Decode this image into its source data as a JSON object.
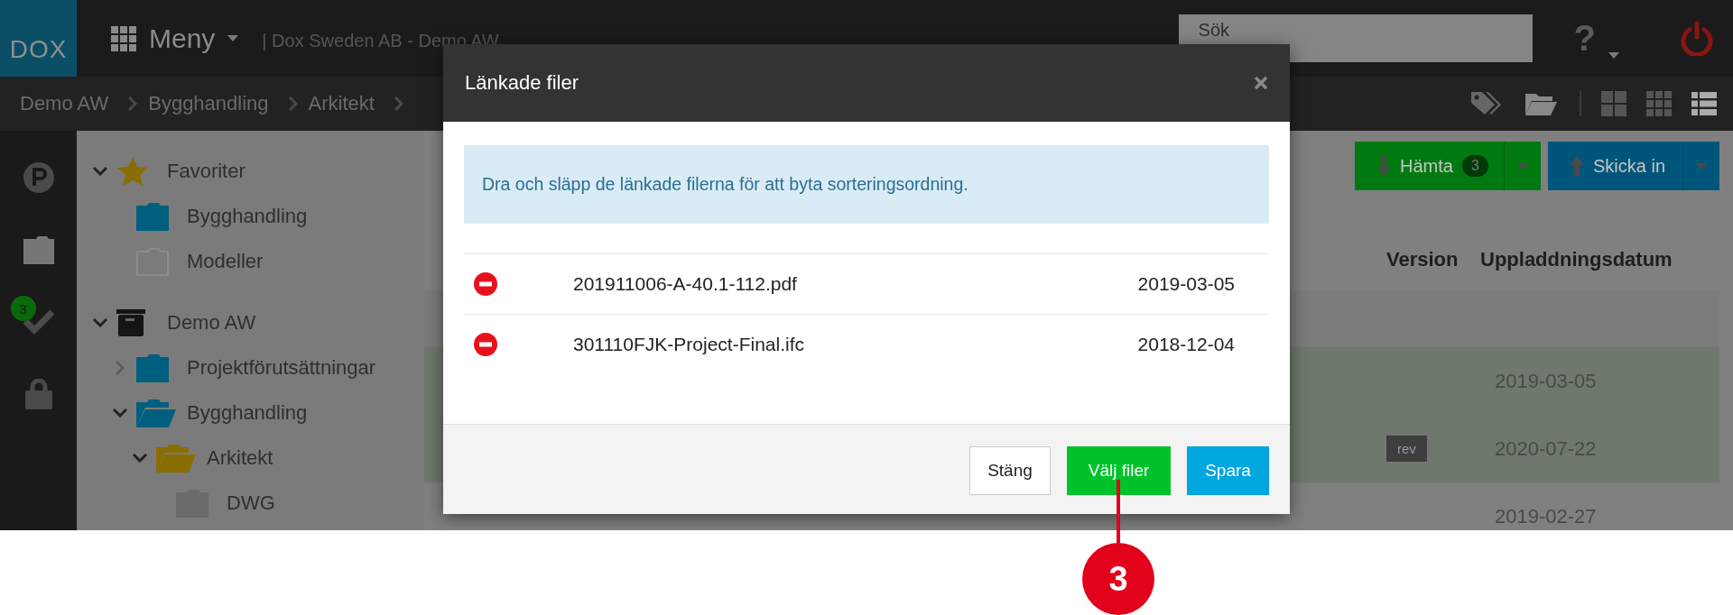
{
  "top_bar": {
    "logo": "DOX",
    "menu_label": "Meny",
    "company": "| Dox Sweden AB - Demo AW",
    "search": {
      "placeholder": "Sök"
    },
    "help": "?"
  },
  "breadcrumb": [
    "Demo AW",
    "Bygghandling",
    "Arkitekt"
  ],
  "rail": [
    {
      "kind": "parking"
    },
    {
      "kind": "folder"
    },
    {
      "kind": "check",
      "badge": "3"
    },
    {
      "kind": "lock"
    }
  ],
  "tree": [
    {
      "label": "Favoriter",
      "kind": "star",
      "expanded": true,
      "children": [
        {
          "label": "Bygghandling",
          "kind": "folder",
          "color": "#005f7f"
        },
        {
          "label": "Modeller",
          "kind": "empty"
        }
      ]
    },
    {
      "label": "Demo AW",
      "kind": "archive",
      "expanded": true,
      "children": [
        {
          "label": "Projektförutsättningar",
          "kind": "folder",
          "color": "#005f7f",
          "expanded": false
        },
        {
          "label": "Bygghandling",
          "kind": "open",
          "color": "#005f7f",
          "expanded": true,
          "children": [
            {
              "label": "Arkitekt",
              "kind": "open",
              "color": "#8a6d00",
              "expanded": true,
              "children": [
                {
                  "label": "DWG",
                  "kind": "folder",
                  "color": "#6a6a6a"
                }
              ]
            }
          ]
        }
      ]
    }
  ],
  "actions": [
    {
      "kind": "download",
      "label": "Hämta",
      "badge": "3"
    },
    {
      "kind": "upload",
      "label": "Skicka in"
    }
  ],
  "table": {
    "columns": [
      "Version",
      "Uppladdningsdatum"
    ],
    "rows": [
      {
        "kind": "group"
      },
      {
        "kind": "file",
        "highlighted": true,
        "date": "2019-03-05"
      },
      {
        "kind": "file",
        "highlighted": true,
        "version_tag": "rev",
        "date": "2020-07-22"
      },
      {
        "kind": "file",
        "highlighted": false,
        "date": "2019-02-27"
      }
    ]
  },
  "modal": {
    "title": "Länkade filer",
    "info": "Dra och släpp de länkade filerna för att byta sorteringsordning.",
    "files": [
      {
        "name": "201911006-A-40.1-112.pdf",
        "date": "2019-03-05"
      },
      {
        "name": "301110FJK-Project-Final.ifc",
        "date": "2018-12-04"
      }
    ],
    "buttons": [
      {
        "kind": "default",
        "label": "Stäng"
      },
      {
        "kind": "success",
        "label": "Välj filer"
      },
      {
        "kind": "primary",
        "label": "Spara"
      }
    ]
  },
  "callout": {
    "number": "3"
  }
}
